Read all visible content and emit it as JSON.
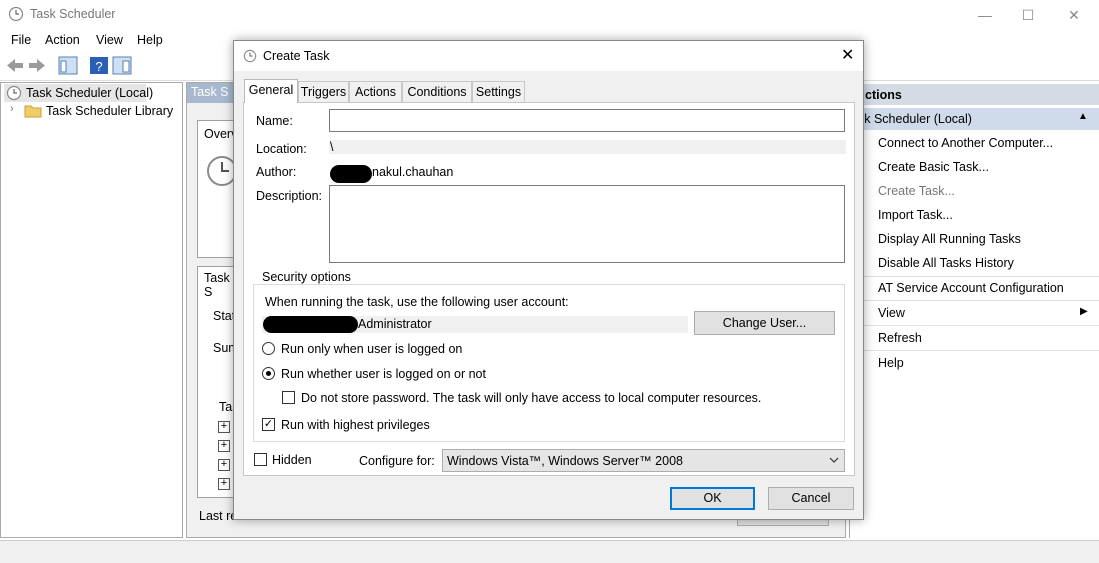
{
  "window": {
    "title": "Task Scheduler",
    "minimize": "—",
    "maximize": "☐",
    "close": "✕"
  },
  "menu": [
    "File",
    "Action",
    "View",
    "Help"
  ],
  "tree": {
    "root": "Task Scheduler (Local)",
    "library": "Task Scheduler Library"
  },
  "center": {
    "header": "Task S",
    "overview_tab": "Overv",
    "task_status_tab": "Task S",
    "status_label": "Stat",
    "summary_label": "Sum",
    "tasks_col": "Tas",
    "last_refreshed": "Last re"
  },
  "actions": {
    "header": "ctions",
    "subheader": "sk Scheduler (Local)",
    "items": [
      {
        "label": "Connect to Another Computer...",
        "disabled": false
      },
      {
        "label": "Create Basic Task...",
        "disabled": false
      },
      {
        "label": "Create Task...",
        "disabled": true
      },
      {
        "label": "Import Task...",
        "disabled": false
      },
      {
        "label": "Display All Running Tasks",
        "disabled": false
      },
      {
        "label": "Disable All Tasks History",
        "disabled": false
      },
      {
        "label": "AT Service Account Configuration",
        "disabled": false
      },
      {
        "label": "View",
        "disabled": false
      },
      {
        "label": "Refresh",
        "disabled": false
      },
      {
        "label": "Help",
        "disabled": false
      }
    ]
  },
  "dialog": {
    "title": "Create Task",
    "close": "✕",
    "tabs": [
      "General",
      "Triggers",
      "Actions",
      "Conditions",
      "Settings"
    ],
    "active_tab": "General",
    "name_label": "Name:",
    "name_value": "",
    "location_label": "Location:",
    "location_value": "\\",
    "author_label": "Author:",
    "author_value": "nakul.chauhan",
    "description_label": "Description:",
    "description_value": "",
    "security_label": "Security options",
    "account_prompt": "When running the task, use the following user account:",
    "account_value": "Administrator",
    "change_user": "Change User...",
    "radio_logged_on": "Run only when user is logged on",
    "radio_whether": "Run whether user is logged on or not",
    "radio_selected": "whether",
    "no_store_password": "Do not store password.  The task will only have access to local computer resources.",
    "no_store_checked": false,
    "highest_privileges": "Run with highest privileges",
    "highest_checked": true,
    "hidden_label": "Hidden",
    "hidden_checked": false,
    "configure_label": "Configure for:",
    "configure_value": "Windows Vista™, Windows Server™ 2008",
    "ok": "OK",
    "cancel": "Cancel"
  }
}
